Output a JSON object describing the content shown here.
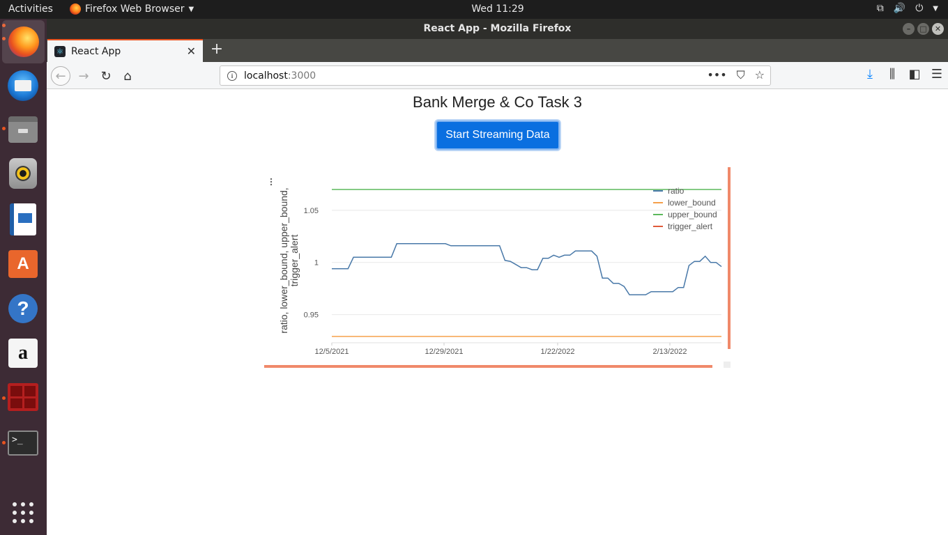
{
  "topbar": {
    "activities": "Activities",
    "app_name": "Firefox Web Browser",
    "clock": "Wed 11:29"
  },
  "window": {
    "title": "React App - Mozilla Firefox"
  },
  "tab": {
    "title": "React App"
  },
  "urlbar": {
    "host": "localhost",
    "port": ":3000"
  },
  "page": {
    "title": "Bank Merge & Co Task 3",
    "button_label": "Start Streaming Data"
  },
  "colors": {
    "ratio": "#4878a8",
    "lower_bound": "#f5a04a",
    "upper_bound": "#5cb85c",
    "trigger_alert": "#e05a3a",
    "accent_bar": "#f0896a",
    "button": "#0a6fe0"
  },
  "chart_data": {
    "type": "line",
    "ylabel": "ratio, lower_bound, upper_bound, trigger_alert",
    "x_tick_labels": [
      "12/5/2021",
      "12/29/2021",
      "1/22/2022",
      "2/13/2022"
    ],
    "y_tick_labels": [
      "1.05",
      "1",
      "0.95"
    ],
    "y_ticks": [
      1.05,
      1.0,
      0.95
    ],
    "ylim": [
      0.923,
      1.08
    ],
    "grid": true,
    "legend_position": "top-right",
    "series": [
      {
        "name": "ratio",
        "values": [
          0.994,
          0.994,
          0.994,
          0.994,
          1.005,
          1.005,
          1.005,
          1.005,
          1.005,
          1.005,
          1.005,
          1.005,
          1.018,
          1.018,
          1.018,
          1.018,
          1.018,
          1.018,
          1.018,
          1.018,
          1.018,
          1.018,
          1.016,
          1.016,
          1.016,
          1.016,
          1.016,
          1.016,
          1.016,
          1.016,
          1.016,
          1.016,
          1.002,
          1.001,
          0.998,
          0.995,
          0.995,
          0.993,
          0.993,
          1.004,
          1.004,
          1.007,
          1.005,
          1.007,
          1.007,
          1.011,
          1.011,
          1.011,
          1.011,
          1.006,
          0.985,
          0.985,
          0.98,
          0.98,
          0.977,
          0.969,
          0.969,
          0.969,
          0.969,
          0.972,
          0.972,
          0.972,
          0.972,
          0.972,
          0.976,
          0.976,
          0.997,
          1.001,
          1.001,
          1.006,
          1.0,
          1.0,
          0.996
        ]
      },
      {
        "name": "lower_bound",
        "values": [
          0.929,
          0.929
        ]
      },
      {
        "name": "upper_bound",
        "values": [
          1.07,
          1.07
        ]
      },
      {
        "name": "trigger_alert",
        "values": []
      }
    ]
  }
}
